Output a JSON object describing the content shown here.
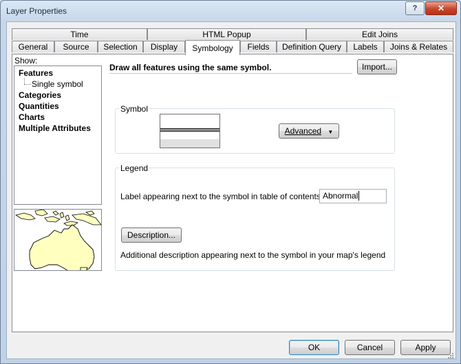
{
  "window": {
    "title": "Layer Properties",
    "help_label": "?",
    "close_label": "✕"
  },
  "tabs_top": [
    "Time",
    "HTML Popup",
    "Edit Joins"
  ],
  "tabs_bottom": [
    "General",
    "Source",
    "Selection",
    "Display",
    "Symbology",
    "Fields",
    "Definition Query",
    "Labels",
    "Joins & Relates"
  ],
  "active_tab": "Symbology",
  "show": {
    "label": "Show:",
    "items": [
      "Features",
      "Categories",
      "Quantities",
      "Charts",
      "Multiple Attributes"
    ],
    "subitem": "Single symbol"
  },
  "symbology": {
    "headline": "Draw all features using the same symbol.",
    "import_label": "Import...",
    "symbol_group_title": "Symbol",
    "advanced_label": "Advanced",
    "legend_group_title": "Legend",
    "legend_label_text": "Label appearing next to the symbol in table of contents:",
    "legend_label_value": "Abnormal",
    "description_button": "Description...",
    "description_text": "Additional description appearing next to the symbol in your map's legend"
  },
  "footer": {
    "ok_label": "OK",
    "cancel_label": "Cancel",
    "apply_label": "Apply"
  },
  "colors": {
    "land": "#ffffc0",
    "sea": "#ffffff",
    "accent": "#3c7fb1"
  }
}
